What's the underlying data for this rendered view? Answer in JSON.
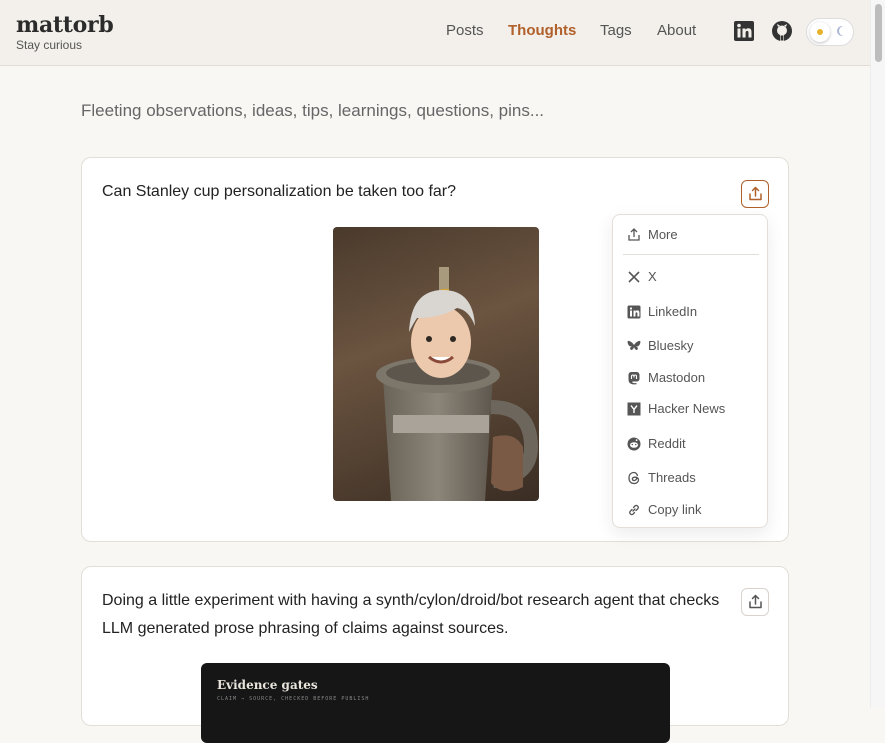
{
  "brand": {
    "title": "mattorb",
    "tagline": "Stay curious"
  },
  "nav": [
    {
      "label": "Posts",
      "active": false
    },
    {
      "label": "Thoughts",
      "active": true
    },
    {
      "label": "Tags",
      "active": false
    },
    {
      "label": "About",
      "active": false
    }
  ],
  "header_icons": [
    "linkedin-icon",
    "github-icon"
  ],
  "intro": "Fleeting observations, ideas, tips, learnings, questions, pins...",
  "posts": [
    {
      "text": "Can Stanley cup personalization be taken too far?"
    },
    {
      "text_line1": "Doing a little experiment with having a synth/cylon/droid/bot research agent that checks",
      "text_line2": "LLM generated prose phrasing of claims against sources.",
      "image_title": "Evidence gates",
      "image_subtitle": "CLAIM → SOURCE, CHECKED BEFORE PUBLISH"
    }
  ],
  "share_menu": [
    {
      "label": "More",
      "icon": "share-icon"
    },
    {
      "label": "X",
      "icon": "x-icon"
    },
    {
      "label": "LinkedIn",
      "icon": "linkedin-icon"
    },
    {
      "label": "Bluesky",
      "icon": "bluesky-icon"
    },
    {
      "label": "Mastodon",
      "icon": "mastodon-icon"
    },
    {
      "label": "Hacker News",
      "icon": "hacker-news-icon"
    },
    {
      "label": "Reddit",
      "icon": "reddit-icon"
    },
    {
      "label": "Threads",
      "icon": "threads-icon"
    },
    {
      "label": "Copy link",
      "icon": "link-icon"
    }
  ],
  "colors": {
    "accent": "#b0602a",
    "background": "#f9f7f4",
    "header": "#f3f0eb"
  }
}
